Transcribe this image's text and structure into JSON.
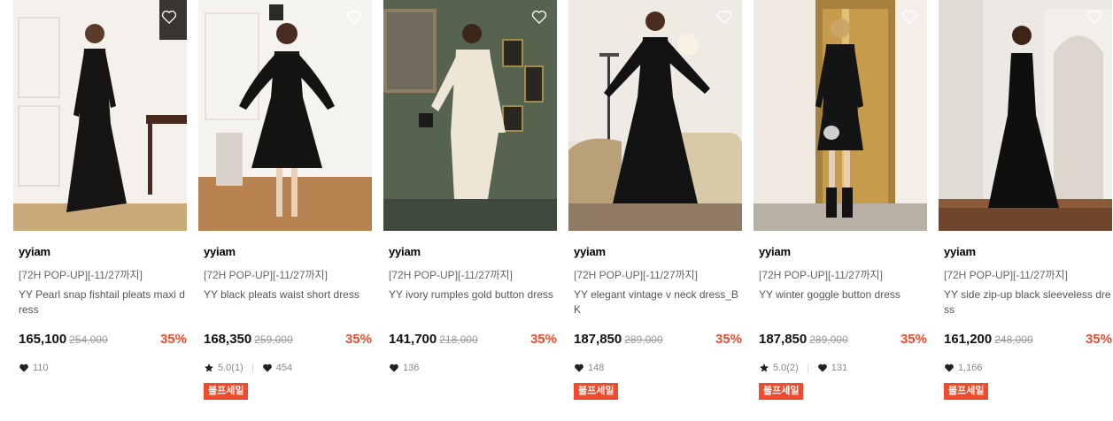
{
  "colors": {
    "accent": "#ef4b2c",
    "text": "#111111",
    "muted": "#888888"
  },
  "products": [
    {
      "brand": "yyiam",
      "promo": "[72H POP-UP][-11/27까지]",
      "name": "YY Pearl snap fishtail pleats maxi dress",
      "price": "165,100",
      "original": "254,000",
      "discount": "35%",
      "rating": "",
      "likes": "110",
      "badge": ""
    },
    {
      "brand": "yyiam",
      "promo": "[72H POP-UP][-11/27까지]",
      "name": "YY black pleats waist short dress",
      "price": "168,350",
      "original": "259,000",
      "discount": "35%",
      "rating": "5.0(1)",
      "likes": "454",
      "badge": "블프세일"
    },
    {
      "brand": "yyiam",
      "promo": "[72H POP-UP][-11/27까지]",
      "name": "YY ivory rumples gold button dress",
      "price": "141,700",
      "original": "218,000",
      "discount": "35%",
      "rating": "",
      "likes": "136",
      "badge": ""
    },
    {
      "brand": "yyiam",
      "promo": "[72H POP-UP][-11/27까지]",
      "name": "YY elegant vintage v neck dress_BK",
      "price": "187,850",
      "original": "289,000",
      "discount": "35%",
      "rating": "",
      "likes": "148",
      "badge": "블프세일"
    },
    {
      "brand": "yyiam",
      "promo": "[72H POP-UP][-11/27까지]",
      "name": "YY winter goggle button dress",
      "price": "187,850",
      "original": "289,000",
      "discount": "35%",
      "rating": "5.0(2)",
      "likes": "131",
      "badge": "블프세일"
    },
    {
      "brand": "yyiam",
      "promo": "[72H POP-UP][-11/27까지]",
      "name": "YY side zip-up black sleeveless dress",
      "price": "161,200",
      "original": "248,000",
      "discount": "35%",
      "rating": "",
      "likes": "1,166",
      "badge": "블프세일"
    }
  ]
}
